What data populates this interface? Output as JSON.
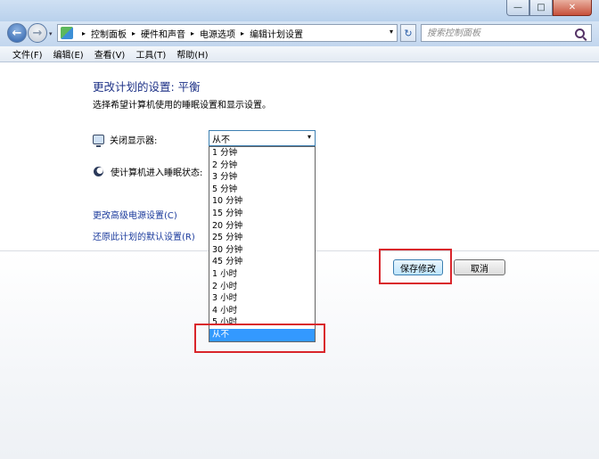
{
  "window": {
    "minimize_label": "—",
    "maximize_label": "□",
    "close_label": "✕"
  },
  "nav": {
    "back_icon": "←",
    "forward_icon": "→",
    "recent_icon": "▾",
    "refresh_icon": "↻"
  },
  "breadcrumb": {
    "items": [
      "控制面板",
      "硬件和声音",
      "电源选项",
      "编辑计划设置"
    ],
    "separator": "▸",
    "dropdown_icon": "▾"
  },
  "search": {
    "placeholder": "搜索控制面板"
  },
  "menu": {
    "items": [
      "文件(F)",
      "编辑(E)",
      "查看(V)",
      "工具(T)",
      "帮助(H)"
    ]
  },
  "page": {
    "heading": "更改计划的设置: 平衡",
    "subtitle": "选择希望计算机使用的睡眠设置和显示设置。",
    "display_label": "关闭显示器:",
    "sleep_label": "使计算机进入睡眠状态:",
    "display_value": "从不",
    "select_arrow": "▾",
    "advanced_link": "更改高级电源设置(C)",
    "restore_link": "还原此计划的默认设置(R)"
  },
  "dropdown": {
    "options": [
      "1 分钟",
      "2 分钟",
      "3 分钟",
      "5 分钟",
      "10 分钟",
      "15 分钟",
      "20 分钟",
      "25 分钟",
      "30 分钟",
      "45 分钟",
      "1 小时",
      "2 小时",
      "3 小时",
      "4 小时",
      "5 小时",
      "从不"
    ],
    "selected_index": 15
  },
  "buttons": {
    "save": "保存修改",
    "cancel": "取消"
  },
  "colors": {
    "highlight": "#d9252b",
    "selection": "#3399ff",
    "link": "#1a3a9c",
    "heading": "#1e3287"
  }
}
